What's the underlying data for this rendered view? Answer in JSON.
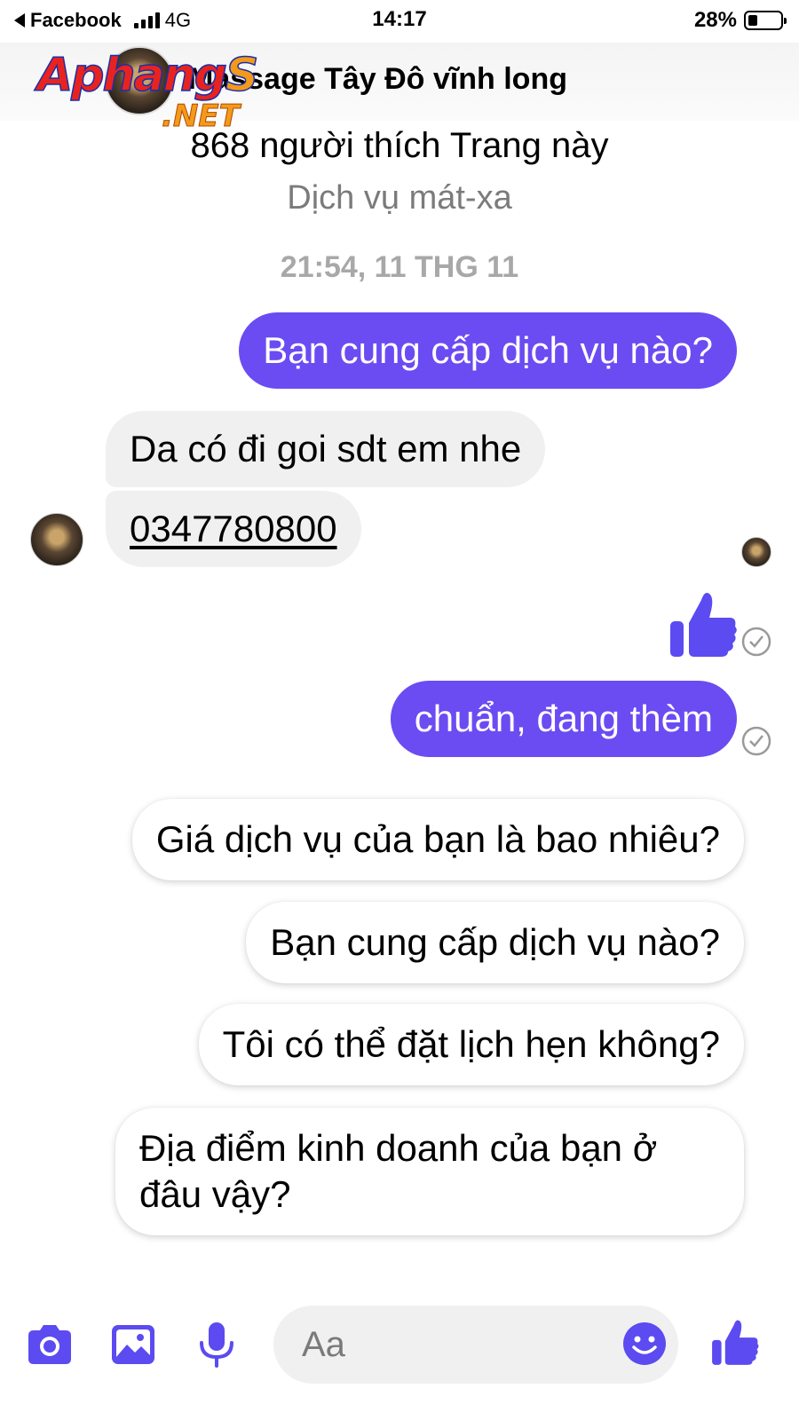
{
  "status_bar": {
    "back_app": "Facebook",
    "network": "4G",
    "time": "14:17",
    "battery": "28%",
    "battery_level": 0.28
  },
  "header": {
    "title": "Massage Tây Đô vĩnh long",
    "likes": "868 người thích Trang này",
    "category": "Dịch vụ mát-xa"
  },
  "watermark": {
    "main": "Aphang",
    "accent": "S",
    "suffix": ".NET"
  },
  "conversation": {
    "timestamp": "21:54, 11 THG 11",
    "messages": [
      {
        "from": "me",
        "text": "Bạn cung cấp dịch vụ nào?"
      },
      {
        "from": "page",
        "text": "Da có đi goi sdt em nhe"
      },
      {
        "from": "page",
        "text": "0347780800",
        "type": "phone-link"
      },
      {
        "from": "me",
        "type": "like-sticker",
        "icon": "thumbs-up-icon"
      },
      {
        "from": "me",
        "text": "chuẩn, đang thèm"
      }
    ]
  },
  "quick_replies": [
    "Giá dịch vụ của bạn là bao nhiêu?",
    "Bạn cung cấp dịch vụ nào?",
    "Tôi có thể đặt lịch hẹn không?",
    "Địa điểm kinh doanh của bạn ở đâu vậy?"
  ],
  "composer": {
    "placeholder": "Aa",
    "icons": [
      "camera-icon",
      "image-icon",
      "microphone-icon",
      "emoji-icon",
      "thumbs-up-icon"
    ]
  },
  "colors": {
    "accent": "#6a4cf2",
    "icon_blue": "#5b4bf0",
    "incoming_bubble": "#f0f0f0",
    "muted_text": "#7b7b7b"
  }
}
